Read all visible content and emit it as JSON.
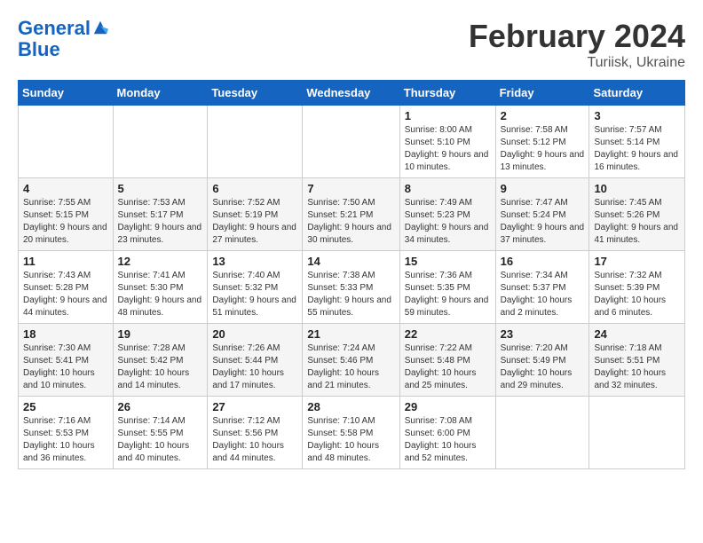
{
  "logo": {
    "line1": "General",
    "line2": "Blue"
  },
  "title": "February 2024",
  "subtitle": "Turiisk, Ukraine",
  "days_of_week": [
    "Sunday",
    "Monday",
    "Tuesday",
    "Wednesday",
    "Thursday",
    "Friday",
    "Saturday"
  ],
  "weeks": [
    [
      {
        "day": "",
        "info": ""
      },
      {
        "day": "",
        "info": ""
      },
      {
        "day": "",
        "info": ""
      },
      {
        "day": "",
        "info": ""
      },
      {
        "day": "1",
        "info": "Sunrise: 8:00 AM\nSunset: 5:10 PM\nDaylight: 9 hours\nand 10 minutes."
      },
      {
        "day": "2",
        "info": "Sunrise: 7:58 AM\nSunset: 5:12 PM\nDaylight: 9 hours\nand 13 minutes."
      },
      {
        "day": "3",
        "info": "Sunrise: 7:57 AM\nSunset: 5:14 PM\nDaylight: 9 hours\nand 16 minutes."
      }
    ],
    [
      {
        "day": "4",
        "info": "Sunrise: 7:55 AM\nSunset: 5:15 PM\nDaylight: 9 hours\nand 20 minutes."
      },
      {
        "day": "5",
        "info": "Sunrise: 7:53 AM\nSunset: 5:17 PM\nDaylight: 9 hours\nand 23 minutes."
      },
      {
        "day": "6",
        "info": "Sunrise: 7:52 AM\nSunset: 5:19 PM\nDaylight: 9 hours\nand 27 minutes."
      },
      {
        "day": "7",
        "info": "Sunrise: 7:50 AM\nSunset: 5:21 PM\nDaylight: 9 hours\nand 30 minutes."
      },
      {
        "day": "8",
        "info": "Sunrise: 7:49 AM\nSunset: 5:23 PM\nDaylight: 9 hours\nand 34 minutes."
      },
      {
        "day": "9",
        "info": "Sunrise: 7:47 AM\nSunset: 5:24 PM\nDaylight: 9 hours\nand 37 minutes."
      },
      {
        "day": "10",
        "info": "Sunrise: 7:45 AM\nSunset: 5:26 PM\nDaylight: 9 hours\nand 41 minutes."
      }
    ],
    [
      {
        "day": "11",
        "info": "Sunrise: 7:43 AM\nSunset: 5:28 PM\nDaylight: 9 hours\nand 44 minutes."
      },
      {
        "day": "12",
        "info": "Sunrise: 7:41 AM\nSunset: 5:30 PM\nDaylight: 9 hours\nand 48 minutes."
      },
      {
        "day": "13",
        "info": "Sunrise: 7:40 AM\nSunset: 5:32 PM\nDaylight: 9 hours\nand 51 minutes."
      },
      {
        "day": "14",
        "info": "Sunrise: 7:38 AM\nSunset: 5:33 PM\nDaylight: 9 hours\nand 55 minutes."
      },
      {
        "day": "15",
        "info": "Sunrise: 7:36 AM\nSunset: 5:35 PM\nDaylight: 9 hours\nand 59 minutes."
      },
      {
        "day": "16",
        "info": "Sunrise: 7:34 AM\nSunset: 5:37 PM\nDaylight: 10 hours\nand 2 minutes."
      },
      {
        "day": "17",
        "info": "Sunrise: 7:32 AM\nSunset: 5:39 PM\nDaylight: 10 hours\nand 6 minutes."
      }
    ],
    [
      {
        "day": "18",
        "info": "Sunrise: 7:30 AM\nSunset: 5:41 PM\nDaylight: 10 hours\nand 10 minutes."
      },
      {
        "day": "19",
        "info": "Sunrise: 7:28 AM\nSunset: 5:42 PM\nDaylight: 10 hours\nand 14 minutes."
      },
      {
        "day": "20",
        "info": "Sunrise: 7:26 AM\nSunset: 5:44 PM\nDaylight: 10 hours\nand 17 minutes."
      },
      {
        "day": "21",
        "info": "Sunrise: 7:24 AM\nSunset: 5:46 PM\nDaylight: 10 hours\nand 21 minutes."
      },
      {
        "day": "22",
        "info": "Sunrise: 7:22 AM\nSunset: 5:48 PM\nDaylight: 10 hours\nand 25 minutes."
      },
      {
        "day": "23",
        "info": "Sunrise: 7:20 AM\nSunset: 5:49 PM\nDaylight: 10 hours\nand 29 minutes."
      },
      {
        "day": "24",
        "info": "Sunrise: 7:18 AM\nSunset: 5:51 PM\nDaylight: 10 hours\nand 32 minutes."
      }
    ],
    [
      {
        "day": "25",
        "info": "Sunrise: 7:16 AM\nSunset: 5:53 PM\nDaylight: 10 hours\nand 36 minutes."
      },
      {
        "day": "26",
        "info": "Sunrise: 7:14 AM\nSunset: 5:55 PM\nDaylight: 10 hours\nand 40 minutes."
      },
      {
        "day": "27",
        "info": "Sunrise: 7:12 AM\nSunset: 5:56 PM\nDaylight: 10 hours\nand 44 minutes."
      },
      {
        "day": "28",
        "info": "Sunrise: 7:10 AM\nSunset: 5:58 PM\nDaylight: 10 hours\nand 48 minutes."
      },
      {
        "day": "29",
        "info": "Sunrise: 7:08 AM\nSunset: 6:00 PM\nDaylight: 10 hours\nand 52 minutes."
      },
      {
        "day": "",
        "info": ""
      },
      {
        "day": "",
        "info": ""
      }
    ]
  ]
}
